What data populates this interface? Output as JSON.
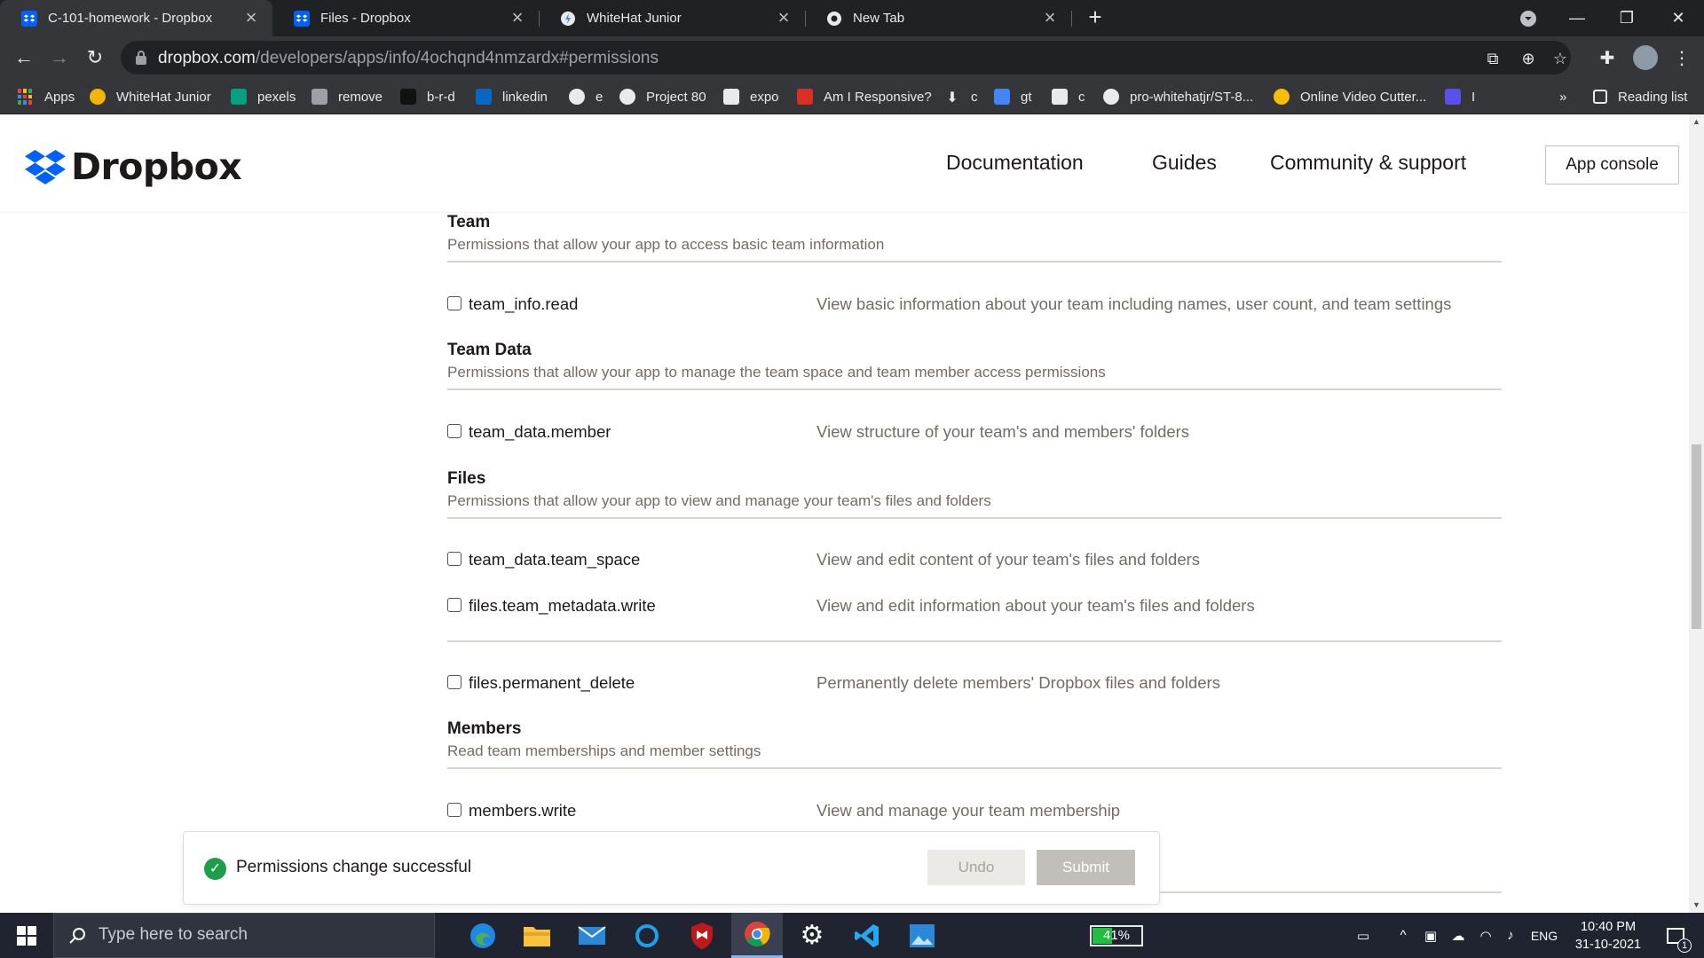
{
  "browser": {
    "tabs": [
      {
        "title": "C-101-homework - Dropbox",
        "active": true
      },
      {
        "title": "Files - Dropbox",
        "active": false
      },
      {
        "title": "WhiteHat Junior",
        "active": false
      },
      {
        "title": "New Tab",
        "active": false
      }
    ],
    "url_host": "dropbox.com",
    "url_path": "/developers/apps/info/4ochqnd4nmzardx#permissions",
    "bookmarks": [
      {
        "label": "Apps",
        "color": "#4285f4"
      },
      {
        "label": "WhiteHat Junior",
        "color": "#f4b400"
      },
      {
        "label": "pexels",
        "color": "#05a081"
      },
      {
        "label": "remove",
        "color": "#9aa0a6"
      },
      {
        "label": "b-r-d",
        "color": "#444444"
      },
      {
        "label": "linkedin",
        "color": "#0a66c2"
      },
      {
        "label": "e",
        "color": "#e8eaed"
      },
      {
        "label": "Project 80",
        "color": "#e8eaed"
      },
      {
        "label": "expo",
        "color": "#e8eaed"
      },
      {
        "label": "Am I Responsive?",
        "color": "#d93025"
      },
      {
        "label": "c",
        "color": "#e8eaed"
      },
      {
        "label": "gt",
        "color": "#4285f4"
      },
      {
        "label": "c",
        "color": "#e8eaed"
      },
      {
        "label": "pro-whitehatjr/ST-8...",
        "color": "#e8eaed"
      },
      {
        "label": "Online Video Cutter...",
        "color": "#fbbc04"
      },
      {
        "label": "I",
        "color": "#5b4fe9"
      }
    ],
    "more_bookmarks": "»",
    "reading_list": "Reading list"
  },
  "site": {
    "brand": "Dropbox",
    "brand_color": "#0061fe",
    "nav": [
      "Documentation",
      "Guides",
      "Community & support"
    ],
    "app_console": "App console"
  },
  "sections": {
    "team": {
      "title": "Team",
      "desc": "Permissions that allow your app to access basic team information"
    },
    "team_data": {
      "title": "Team Data",
      "desc": "Permissions that allow your app to manage the team space and team member access permissions"
    },
    "files": {
      "title": "Files",
      "desc": "Permissions that allow your app to view and manage your team's files and folders"
    },
    "members": {
      "title": "Members",
      "desc": "Read team memberships and member settings"
    }
  },
  "permissions": {
    "team_info_read": {
      "name": "team_info.read",
      "desc": "View basic information about your team including names, user count, and team settings",
      "checked": false
    },
    "team_data_member": {
      "name": "team_data.member",
      "desc": "View structure of your team's and members' folders",
      "checked": false
    },
    "team_data_team_space": {
      "name": "team_data.team_space",
      "desc": "View and edit content of your team's files and folders",
      "checked": false
    },
    "files_team_metadata_write": {
      "name": "files.team_metadata.write",
      "desc": "View and edit information about your team's files and folders",
      "checked": false
    },
    "files_permanent_delete": {
      "name": "files.permanent_delete",
      "desc": "Permanently delete members' Dropbox files and folders",
      "checked": false
    },
    "members_write": {
      "name": "members.write",
      "desc": "View and manage your team membership",
      "checked": false
    }
  },
  "toast": {
    "message": "Permissions change successful",
    "undo": "Undo",
    "submit": "Submit",
    "success_color": "#1e9e4a"
  },
  "taskbar": {
    "search_placeholder": "Type here to search",
    "battery": "41%",
    "battery_level": 0.41,
    "language": "ENG",
    "time": "10:40 PM",
    "date": "31-10-2021",
    "notifications": "1"
  }
}
